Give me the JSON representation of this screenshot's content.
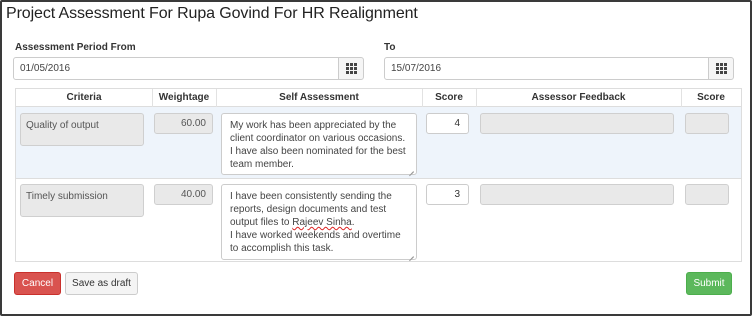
{
  "page": {
    "title": "Project Assessment For Rupa Govind For HR Realignment"
  },
  "period": {
    "from_label": "Assessment Period From",
    "from_value": "01/05/2016",
    "to_label": "To",
    "to_value": "15/07/2016"
  },
  "table": {
    "headers": {
      "criteria": "Criteria",
      "weightage": "Weightage",
      "self_assessment": "Self Assessment",
      "score": "Score",
      "assessor_feedback": "Assessor Feedback",
      "assessor_score": "Score"
    },
    "rows": [
      {
        "criteria": "Quality of output",
        "weightage": "60.00",
        "self_assessment": "My work has been appreciated by the client coordinator on various occasions. I have also been nominated for the best team member.",
        "score": "4",
        "assessor_feedback": "",
        "assessor_score": ""
      },
      {
        "criteria": "Timely submission",
        "weightage": "40.00",
        "self_assessment_line1": "I have been consistently sending the reports, design documents and test output files to ",
        "self_assessment_name": "Rajeev Sinha",
        "self_assessment_line2": ".",
        "self_assessment_line3": "I have worked weekends and overtime to accomplish this task.",
        "score": "3",
        "assessor_feedback": "",
        "assessor_score": ""
      }
    ]
  },
  "actions": {
    "cancel_label": "Cancel",
    "draft_label": "Save as draft",
    "submit_label": "Submit"
  },
  "colors": {
    "cancel": "#d9534f",
    "submit": "#5cb85c",
    "row_highlight": "#eef4fb"
  },
  "icons": {
    "calendar": "calendar-grid-icon",
    "resize": "resize-grip-icon"
  }
}
